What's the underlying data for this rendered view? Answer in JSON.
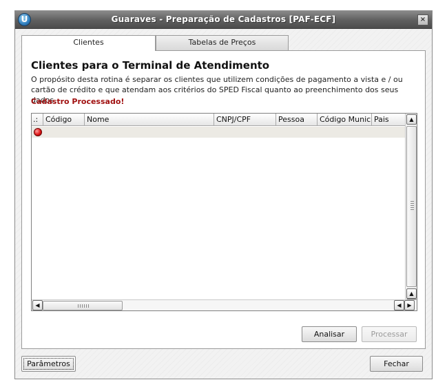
{
  "window": {
    "title": "Guaraves - Preparação de Cadastros [PAF-ECF]",
    "app_icon_glyph": "U",
    "close_glyph": "×"
  },
  "tabs": [
    {
      "label": "Clientes",
      "active": true
    },
    {
      "label": "Tabelas de Preços",
      "active": false
    }
  ],
  "content": {
    "heading": "Clientes para o Terminal de Atendimento",
    "description": "O propósito desta rotina é separar os clientes que utilizem condições de pagamento a vista e / ou cartão de crédito e que atendam aos critérios do SPED Fiscal quanto ao preenchimento dos seus dados.",
    "status_text": "Cadastro Processado!"
  },
  "grid": {
    "columns": [
      ".:",
      "Código",
      "Nome",
      "CNPJ/CPF",
      "Pessoa",
      "Código Municip",
      "Pais"
    ],
    "rows": [
      {
        "status_icon": "red-status-icon",
        "values": [
          "",
          "",
          "",
          "",
          "",
          ""
        ]
      }
    ]
  },
  "scrollbars": {
    "up_glyph": "▲",
    "down_glyph": "▼",
    "left_glyph": "◀",
    "right_glyph": "▶"
  },
  "buttons": {
    "analisar": "Analisar",
    "processar": "Processar",
    "parametros": "Parâmetros",
    "fechar": "Fechar"
  },
  "colors": {
    "status_text": "#a01010",
    "status_icon": "#e01818"
  }
}
